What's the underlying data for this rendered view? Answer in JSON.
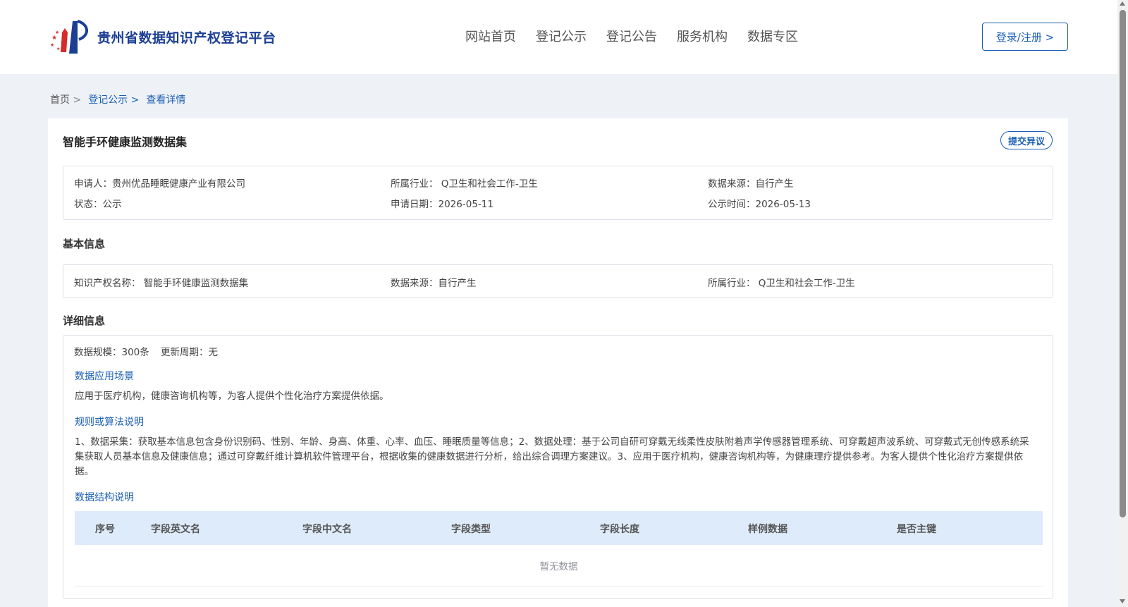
{
  "header": {
    "site_name": "贵州省数据知识产权登记平台",
    "nav": [
      "网站首页",
      "登记公示",
      "登记公告",
      "服务机构",
      "数据专区"
    ],
    "login_label": "登录/注册 >"
  },
  "breadcrumb": {
    "home": "首页",
    "sep": ">",
    "level1": "登记公示",
    "current": "查看详情"
  },
  "detail": {
    "title": "智能手环健康监测数据集",
    "objection_label": "提交异议",
    "summary": {
      "applicant": "申请人：贵州优品睡眠健康产业有限公司",
      "industry": "所属行业： Q卫生和社会工作-卫生",
      "source": "数据来源：自行产生",
      "status": "状态：公示",
      "apply_date": "申请日期：2026-05-11",
      "publish_date": "公示时间：2026-05-13"
    },
    "basic_title": "基本信息",
    "basic": {
      "ip_name": "知识产权名称： 智能手环健康监测数据集",
      "source": "数据来源：自行产生",
      "industry": "所属行业： Q卫生和社会工作-卫生"
    },
    "detail_title": "详细信息",
    "scale": "数据规模：300条",
    "update_cycle": "更新周期：无",
    "scenario_title": "数据应用场景",
    "scenario_text": "应用于医疗机构，健康咨询机构等，为客人提供个性化治疗方案提供依据。",
    "algorithm_title": "规则或算法说明",
    "algorithm_text": "1、数据采集：获取基本信息包含身份识别码、性别、年龄、身高、体重、心率、血压、睡眠质量等信息；2、数据处理：基于公司自研可穿戴无线柔性皮肤附着声学传感器管理系统、可穿戴超声波系统、可穿戴式无创传感系统采集获取人员基本信息及健康信息；通过可穿戴纤维计算机软件管理平台，根据收集的健康数据进行分析，给出综合调理方案建议。3、应用于医疗机构，健康咨询机构等，为健康理疗提供参考。为客人提供个性化治疗方案提供依据。",
    "structure_title": "数据结构说明",
    "table": {
      "headers": [
        "序号",
        "字段英文名",
        "字段中文名",
        "字段类型",
        "字段长度",
        "样例数据",
        "是否主键"
      ],
      "empty_text": "暂无数据"
    }
  },
  "colors": {
    "brand": "#1c3f94",
    "link": "#1a5fb4",
    "table_header_bg": "#deebfa",
    "page_bg": "#eef1f5"
  }
}
